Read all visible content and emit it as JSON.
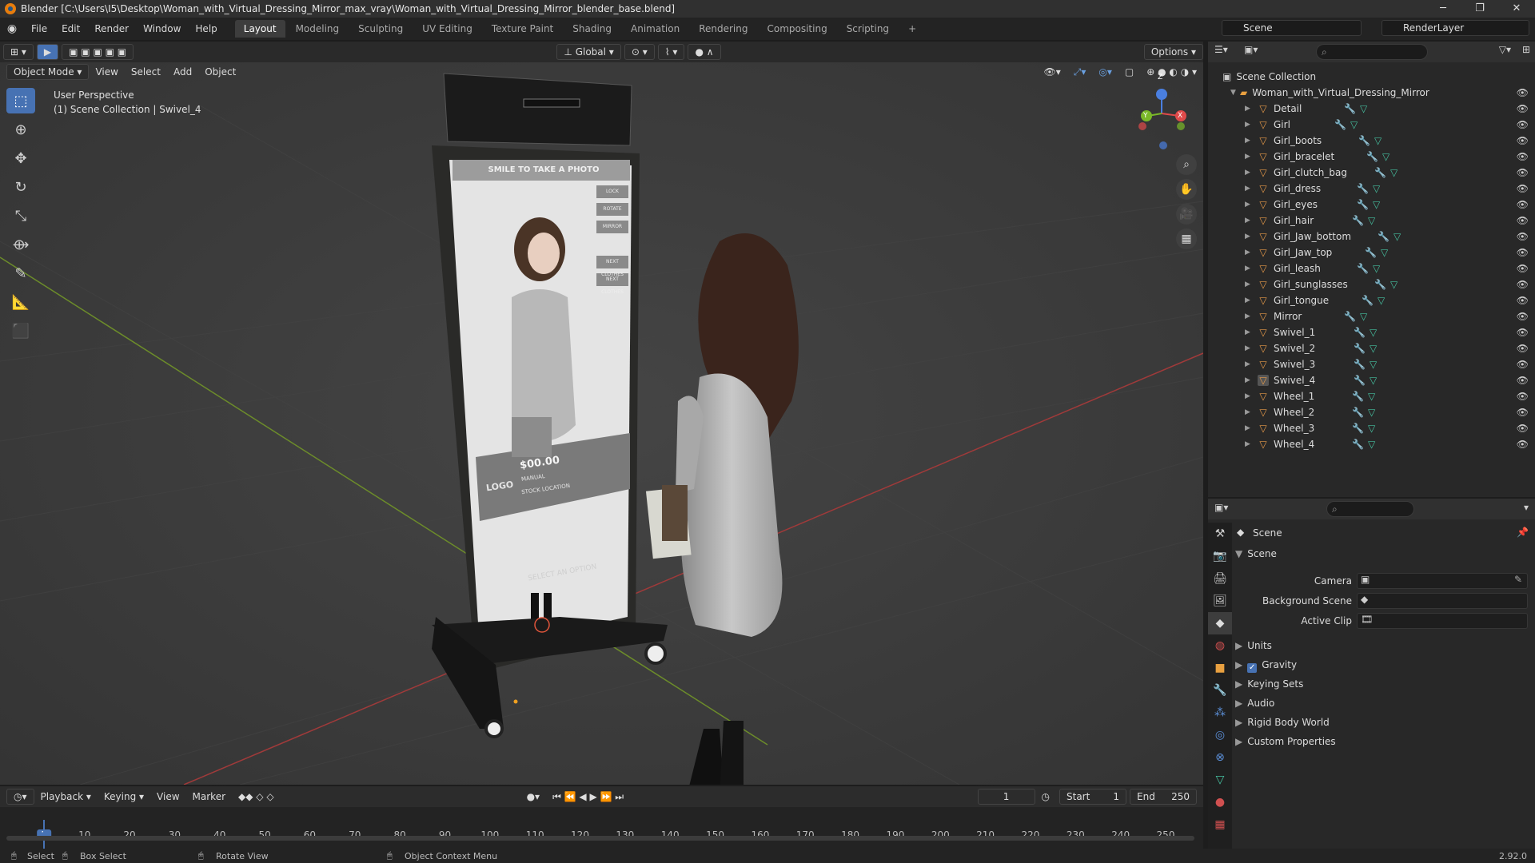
{
  "titlebar": {
    "title": "Blender [C:\\Users\\I5\\Desktop\\Woman_with_Virtual_Dressing_Mirror_max_vray\\Woman_with_Virtual_Dressing_Mirror_blender_base.blend]",
    "minimize": "─",
    "maximize": "❐",
    "close": "✕"
  },
  "menu": [
    "File",
    "Edit",
    "Render",
    "Window",
    "Help"
  ],
  "workspaces": [
    "Layout",
    "Modeling",
    "Sculpting",
    "UV Editing",
    "Texture Paint",
    "Shading",
    "Animation",
    "Rendering",
    "Compositing",
    "Scripting"
  ],
  "active_workspace": "Layout",
  "scene_name": "Scene",
  "render_layer": "RenderLayer",
  "viewport": {
    "transform_orientation": "Global",
    "options": "Options",
    "mode": "Object Mode",
    "menus": [
      "View",
      "Select",
      "Add",
      "Object"
    ],
    "info_line1": "User Perspective",
    "info_line2": "(1) Scene Collection | Swivel_4",
    "mirror_header": "SMILE TO TAKE A PHOTO",
    "mirror_buttons": [
      "LOCK",
      "ROTATE",
      "MIRROR",
      "NEXT CLOTHES",
      "NEXT CLOTHES"
    ],
    "mirror_price": "$00.00",
    "mirror_logo": "LOGO",
    "mirror_sub1": "MANUAL",
    "mirror_sub2": "STOCK LOCATION",
    "mirror_footer": "SELECT AN OPTION",
    "gizmo": {
      "x": "X",
      "y": "Y",
      "z": "Z"
    }
  },
  "outliner": {
    "root": "Scene Collection",
    "collection": "Woman_with_Virtual_Dressing_Mirror",
    "items": [
      "Detail",
      "Girl",
      "Girl_boots",
      "Girl_bracelet",
      "Girl_clutch_bag",
      "Girl_dress",
      "Girl_eyes",
      "Girl_hair",
      "Girl_Jaw_bottom",
      "Girl_Jaw_top",
      "Girl_leash",
      "Girl_sunglasses",
      "Girl_tongue",
      "Mirror",
      "Swivel_1",
      "Swivel_2",
      "Swivel_3",
      "Swivel_4",
      "Wheel_1",
      "Wheel_2",
      "Wheel_3",
      "Wheel_4"
    ],
    "active_item": "Swivel_4"
  },
  "properties": {
    "context": "Scene",
    "panel": "Scene",
    "camera_label": "Camera",
    "background_label": "Background Scene",
    "clip_label": "Active Clip",
    "subpanels": [
      "Units",
      "Gravity",
      "Keying Sets",
      "Audio",
      "Rigid Body World",
      "Custom Properties"
    ],
    "gravity_checked": true
  },
  "timeline": {
    "menus": [
      "Playback",
      "Keying",
      "View",
      "Marker"
    ],
    "current_frame": "1",
    "start_label": "Start",
    "start": "1",
    "end_label": "End",
    "end": "250",
    "ticks": [
      "1",
      "10",
      "20",
      "30",
      "40",
      "50",
      "60",
      "70",
      "80",
      "90",
      "100",
      "110",
      "120",
      "130",
      "140",
      "150",
      "160",
      "170",
      "180",
      "190",
      "200",
      "210",
      "220",
      "230",
      "240",
      "250"
    ]
  },
  "statusbar": {
    "select": "Select",
    "box_select": "Box Select",
    "rotate": "Rotate View",
    "context_menu": "Object Context Menu",
    "version": "2.92.0"
  }
}
